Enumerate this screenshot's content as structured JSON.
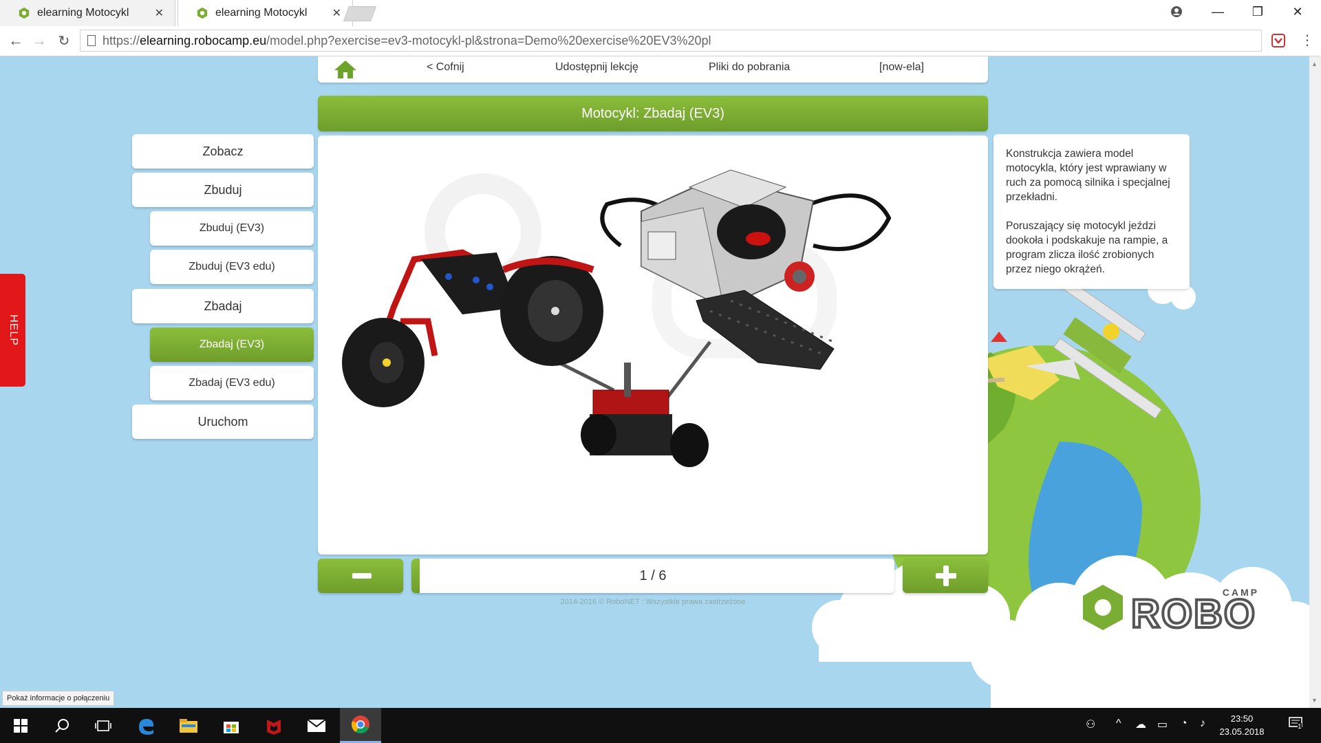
{
  "browser": {
    "tabs": [
      {
        "title": "elearning Motocykl",
        "active": false
      },
      {
        "title": "elearning Motocykl",
        "active": true
      }
    ],
    "url": {
      "scheme": "https://",
      "host": "elearning.robocamp.eu",
      "path": "/model.php?exercise=ev3-motocykl-pl&strona=Demo%20exercise%20EV3%20pl"
    }
  },
  "topnav": {
    "back": "< Cofnij",
    "share": "Udostępnij lekcję",
    "downloads": "Pliki do pobrania",
    "user": "[now-ela]"
  },
  "title": "Motocykl: Zbadaj (EV3)",
  "menu": {
    "see": "Zobacz",
    "build": "Zbuduj",
    "build_ev3": "Zbuduj (EV3)",
    "build_ev3_edu": "Zbuduj (EV3 edu)",
    "explore": "Zbadaj",
    "explore_ev3": "Zbadaj (EV3)",
    "explore_ev3_edu": "Zbadaj (EV3 edu)",
    "run": "Uruchom"
  },
  "description": {
    "p1": "Konstrukcja zawiera model motocykla, który jest wprawiany w ruch za pomocą silnika i specjalnej przekładni.",
    "p2": "Poruszający się motocykl jeździ dookoła i podskakuje na rampie, a program zlicza ilość zrobionych przez niego okrążeń."
  },
  "pager": {
    "current": 1,
    "total": 6,
    "label": "1 / 6",
    "progress_fraction": 0.0167
  },
  "footer": "2014-2016 © RoboNET : Wszystkie prawa zastrzeżone",
  "help": "HELP",
  "logo": {
    "small": "CAMP",
    "big": "ROBO"
  },
  "status_bubble": "Pokaż informacje o połączeniu",
  "taskbar": {
    "time": "23:50",
    "date": "23.05.2018",
    "notification_count": "1"
  },
  "colors": {
    "green": "#7aad33",
    "sky": "#a9d6ef",
    "help_red": "#e2171a"
  }
}
